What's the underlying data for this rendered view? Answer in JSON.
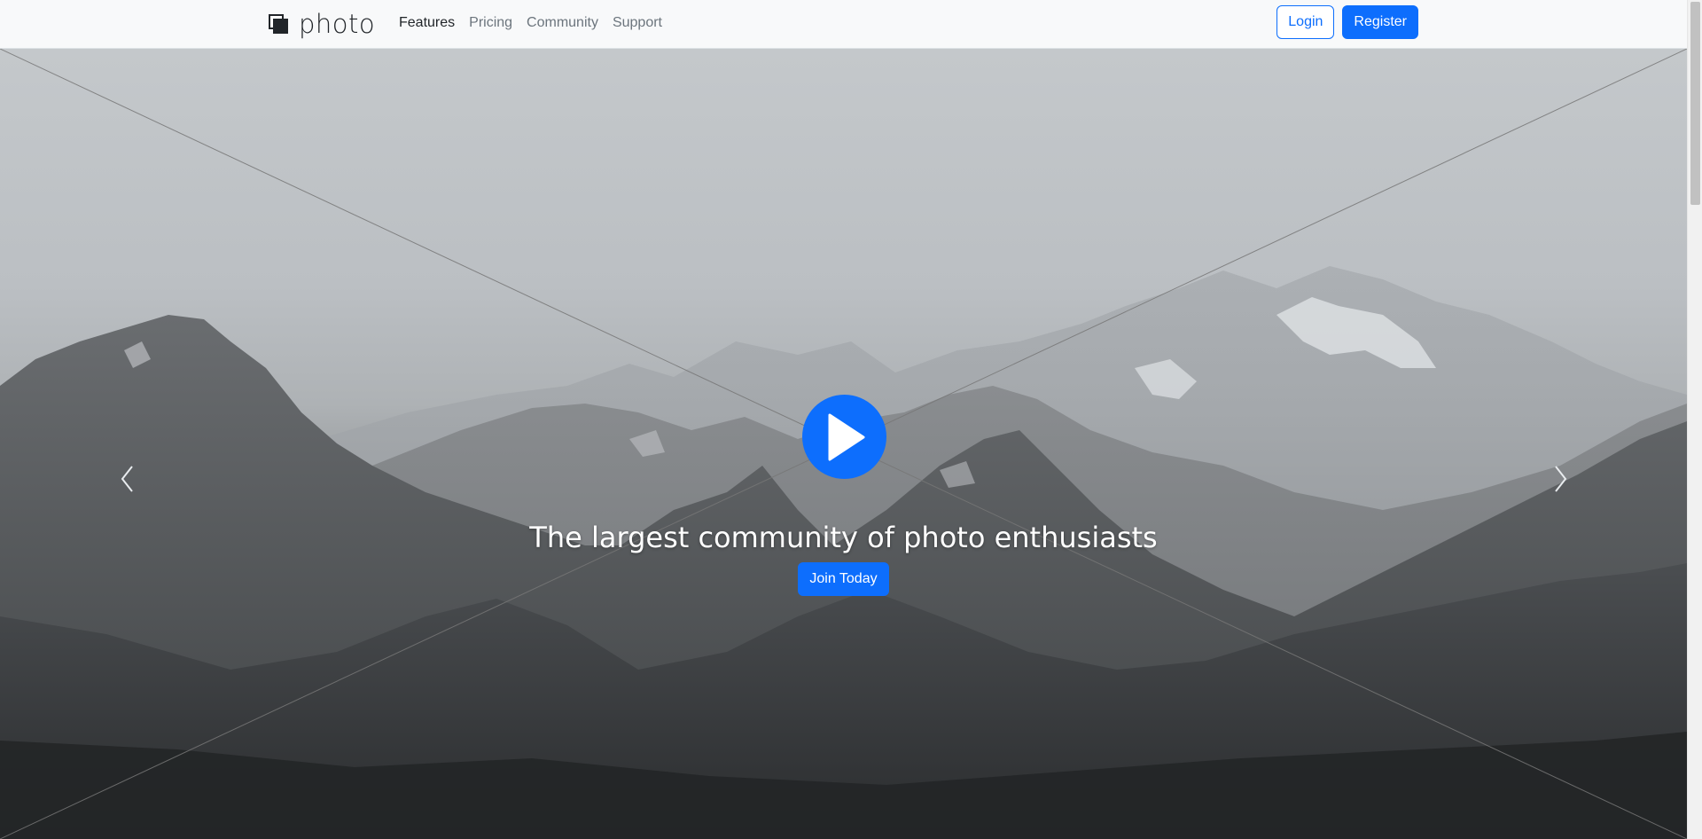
{
  "navbar": {
    "brand": "photo",
    "links": [
      {
        "label": "Features",
        "active": true
      },
      {
        "label": "Pricing",
        "active": false
      },
      {
        "label": "Community",
        "active": false
      },
      {
        "label": "Support",
        "active": false
      }
    ],
    "login_label": "Login",
    "register_label": "Register"
  },
  "hero": {
    "headline": "The largest community of photo enthusiasts",
    "cta_label": "Join Today"
  },
  "colors": {
    "primary": "#0d6efd",
    "navbar_bg": "#f8f9fa",
    "text_dark": "#212529",
    "text_muted": "#6c757d"
  },
  "icons": {
    "logo": "photo-logo-icon",
    "play": "play-icon",
    "prev": "chevron-left-icon",
    "next": "chevron-right-icon"
  }
}
